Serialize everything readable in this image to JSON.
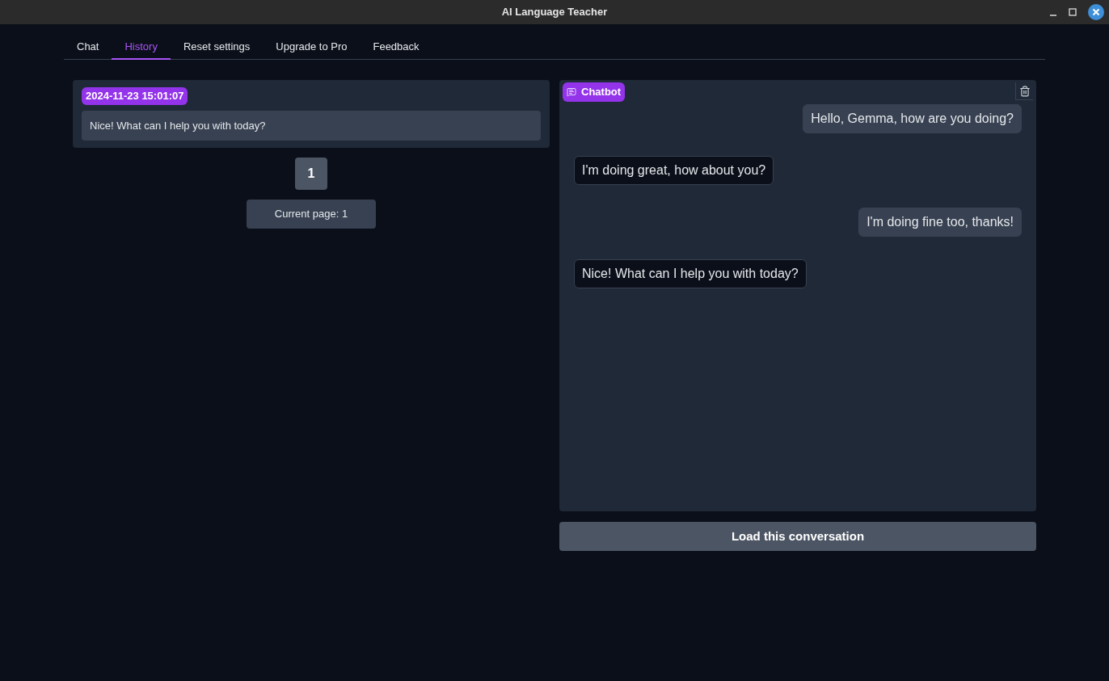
{
  "window": {
    "title": "AI Language Teacher"
  },
  "tabs": [
    {
      "label": "Chat",
      "selected": false
    },
    {
      "label": "History",
      "selected": true
    },
    {
      "label": "Reset settings",
      "selected": false
    },
    {
      "label": "Upgrade to Pro",
      "selected": false
    },
    {
      "label": "Feedback",
      "selected": false
    }
  ],
  "history": {
    "timestamp": "2024-11-23 15:01:07",
    "preview": "Nice! What can I help you with today?",
    "pages": [
      {
        "label": "1",
        "selected": true
      }
    ],
    "current_page": "Current page: 1"
  },
  "chatbot": {
    "label": "Chatbot",
    "messages": [
      {
        "kind": "user",
        "text": "Hello, Gemma, how are you doing?"
      },
      {
        "kind": "bot",
        "text": "I'm doing great, how about you?"
      },
      {
        "kind": "user",
        "text": "I'm doing fine too, thanks!"
      },
      {
        "kind": "bot",
        "text": "Nice! What can I help you with today?"
      }
    ]
  },
  "load_button": "Load this conversation"
}
